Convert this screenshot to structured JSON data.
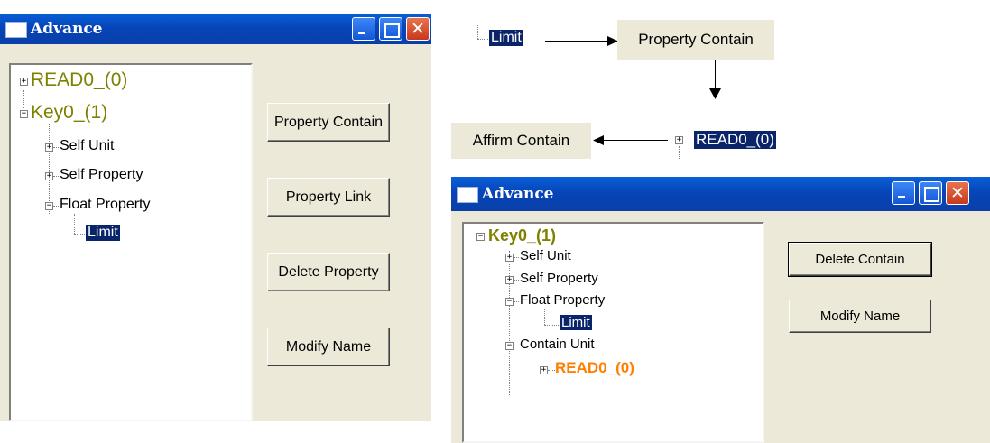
{
  "window1": {
    "title": "Advance",
    "tree": {
      "read0": "READ0_(0)",
      "key0": "Key0_(1)",
      "self_unit": "Self Unit",
      "self_property": "Self Property",
      "float_property": "Float Property",
      "limit": "Limit"
    },
    "buttons": {
      "property_contain": "Property Contain",
      "property_link": "Property Link",
      "delete_property": "Delete Property",
      "modify_name": "Modify Name"
    }
  },
  "flow": {
    "limit": "Limit",
    "property_contain": "Property Contain",
    "affirm_contain": "Affirm Contain",
    "read0": "READ0_(0)"
  },
  "window2": {
    "title": "Advance",
    "tree": {
      "key0": "Key0_(1)",
      "self_unit": "Self Unit",
      "self_property": "Self Property",
      "float_property": "Float Property",
      "limit": "Limit",
      "contain_unit": "Contain Unit",
      "read0": "READ0_(0)"
    },
    "buttons": {
      "delete_contain": "Delete Contain",
      "modify_name": "Modify Name"
    }
  },
  "colors": {
    "title_blue": "#0645b8",
    "olive_text": "#808000",
    "orange_text": "#ff8000",
    "selection": "#0a246a"
  },
  "icons": [
    "app-icon",
    "minimize-icon",
    "maximize-icon",
    "close-icon",
    "plus-box-icon",
    "minus-box-icon",
    "arrow-right-icon",
    "arrow-down-icon",
    "arrow-left-icon"
  ]
}
